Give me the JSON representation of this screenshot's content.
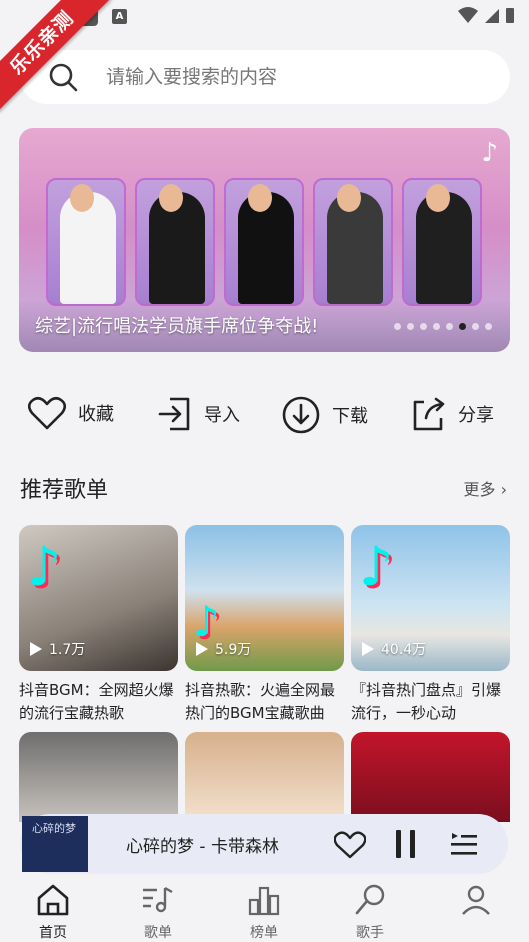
{
  "watermark": "乐乐亲测",
  "search": {
    "placeholder": "请输入要搜索的内容"
  },
  "banner": {
    "caption": "综艺|流行唱法学员旗手席位争夺战!",
    "dots": 8,
    "active_dot": 5
  },
  "actions": [
    {
      "icon": "heart-icon",
      "label": "收藏"
    },
    {
      "icon": "import-icon",
      "label": "导入"
    },
    {
      "icon": "download-icon",
      "label": "下载"
    },
    {
      "icon": "share-icon",
      "label": "分享"
    }
  ],
  "section": {
    "title": "推荐歌单",
    "more": "更多"
  },
  "playlists": [
    {
      "plays": "1.7万",
      "title": "抖音BGM：全网超火爆的流行宝藏热歌"
    },
    {
      "plays": "5.9万",
      "title": "抖音热歌：火遍全网最热门的BGM宝藏歌曲"
    },
    {
      "plays": "40.4万",
      "title": "『抖音热门盘点』引爆流行，一秒心动"
    }
  ],
  "player": {
    "song": "心碎的梦 - 卡带森林",
    "cover_text": "心碎的梦"
  },
  "nav": [
    {
      "icon": "home-icon",
      "label": "首页",
      "active": true
    },
    {
      "icon": "song-icon",
      "label": "歌单",
      "active": false
    },
    {
      "icon": "chart-icon",
      "label": "榜单",
      "active": false
    },
    {
      "icon": "singer-icon",
      "label": "歌手",
      "active": false
    },
    {
      "icon": "mine-icon",
      "label": "",
      "active": false
    }
  ],
  "colors": {
    "background": "#f3f3f6",
    "accent": "#222222",
    "watermark": "#d9252c"
  }
}
